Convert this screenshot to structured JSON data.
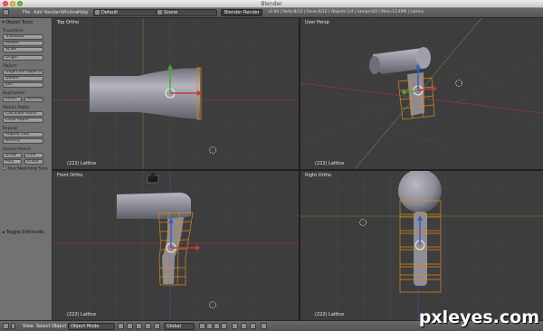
{
  "window": {
    "title": "Blender"
  },
  "infobar": {
    "menu": [
      "File",
      "Add",
      "Render",
      "Window",
      "Help"
    ],
    "layout": "Default",
    "scene": "Scene",
    "render_engine": "Blender Render",
    "stats": "v2.60 | Verts:8/13 | Faces:6/12 | Objects:1/4 | Lamps:0/2 | Mem:13.49M | Lattice"
  },
  "toolshelf": {
    "header": "▾ Object Tools",
    "transform_label": "Transform:",
    "translate": "Translate",
    "rotate": "Rotate",
    "scale": "Scale",
    "origin": "Origin",
    "object_label": "Object:",
    "duplicate": "Duplicate Objects",
    "delete": "Delete",
    "join": "Join",
    "keyframes_label": "Keyframes:",
    "insert": "Insert",
    "remove": "Remove",
    "motion_paths_label": "Motion Paths:",
    "calc_paths": "Calculate Paths",
    "clear_paths": "Clear Paths",
    "repeat_label": "Repeat:",
    "repeat_last": "Repeat Last",
    "history": "History",
    "grease_pencil_label": "Grease Pencil:",
    "draw": "Draw",
    "line": "Line",
    "poly": "Poly",
    "erase": "Erase",
    "use_sketching": "Use Sketching Sess",
    "toggle_editmode": "▸ Toggle Editmode"
  },
  "viewports": {
    "top_ortho": {
      "label": "Top Ortho",
      "footer": "(222) Lattice"
    },
    "user_persp": {
      "label": "User Persp",
      "footer": "(222) Lattice"
    },
    "front_ortho": {
      "label": "Front Ortho",
      "footer": "(222) Lattice"
    },
    "right_ortho": {
      "label": "Right Ortho",
      "footer": "(222) Lattice"
    }
  },
  "bottombar": {
    "view": "View",
    "select": "Select",
    "object": "Object",
    "mode": "Object Mode",
    "pivot": "Global"
  },
  "watermark": "pxleyes.com",
  "colors": {
    "viewport_bg": "#3d3d3d",
    "grid": "#474747",
    "lattice": "#e08a1a",
    "axis_red": "#c23a3a",
    "axis_green": "#4aa83a",
    "axis_blue": "#3a5ccf"
  }
}
